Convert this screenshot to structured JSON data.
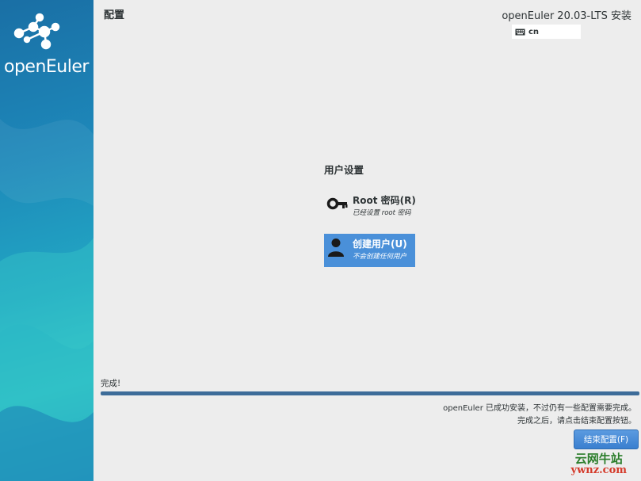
{
  "sidebar": {
    "logo_text": "openEuler"
  },
  "header": {
    "page_title": "配置",
    "product_title": "openEuler 20.03-LTS 安装",
    "keyboard_layout": "cn"
  },
  "main": {
    "section_heading": "用户设置",
    "spokes": [
      {
        "label": "Root 密码(R)",
        "status": "已经设置 root 密码",
        "icon": "key-icon",
        "selected": false
      },
      {
        "label": "创建用户(U)",
        "status": "不会创建任何用户",
        "icon": "user-icon",
        "selected": true
      }
    ]
  },
  "footer": {
    "progress_label": "完成!",
    "progress_fraction": 1.0,
    "info_line_1": "openEuler 已成功安装，不过仍有一些配置需要完成。",
    "info_line_2": "完成之后，请点击结束配置按钮。",
    "finish_button": "结束配置(F)"
  },
  "watermark": {
    "line_1": "云网牛站",
    "line_2": "ywnz.com"
  },
  "colors": {
    "selected_spoke": "#4a90d9",
    "progress_fill": "#3d6c99",
    "finish_button": "#4a8fd9",
    "sidebar": "#1d86b8"
  }
}
